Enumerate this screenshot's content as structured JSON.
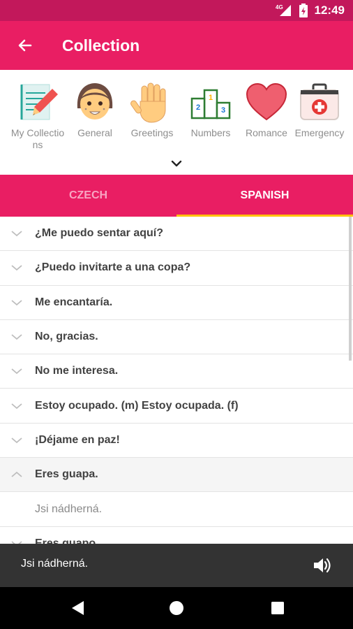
{
  "status_bar": {
    "time": "12:49",
    "network": "4G"
  },
  "app_bar": {
    "title": "Collection",
    "back_icon": "arrow-back-icon"
  },
  "categories": [
    {
      "label": "My Collections",
      "icon": "notepad-pencil-icon"
    },
    {
      "label": "General",
      "icon": "girl-face-icon"
    },
    {
      "label": "Greetings",
      "icon": "waving-hand-icon"
    },
    {
      "label": "Numbers",
      "icon": "podium-icon"
    },
    {
      "label": "Romance",
      "icon": "heart-icon"
    },
    {
      "label": "Emergency",
      "icon": "first-aid-kit-icon"
    }
  ],
  "tabs": {
    "czech": "CZECH",
    "spanish": "SPANISH",
    "selected": "SPANISH"
  },
  "phrases": [
    {
      "text": "¿Me puedo sentar aquí?",
      "expanded": false
    },
    {
      "text": "¿Puedo invitarte a una copa?",
      "expanded": false
    },
    {
      "text": "Me encantaría.",
      "expanded": false
    },
    {
      "text": "No, gracias.",
      "expanded": false
    },
    {
      "text": "No me interesa.",
      "expanded": false
    },
    {
      "text": "Estoy ocupado. (m)  Estoy ocupada. (f)",
      "expanded": false
    },
    {
      "text": "¡Déjame en paz!",
      "expanded": false
    },
    {
      "text": "Eres guapa.",
      "expanded": true,
      "translation": "Jsi nádherná."
    },
    {
      "text": "Eres guapo.",
      "expanded": false
    }
  ],
  "player": {
    "text": "Jsi nádherná.",
    "icon": "speaker-icon"
  },
  "colors": {
    "primary": "#e91e63",
    "status": "#c2185b",
    "indicator": "#ffc107"
  }
}
